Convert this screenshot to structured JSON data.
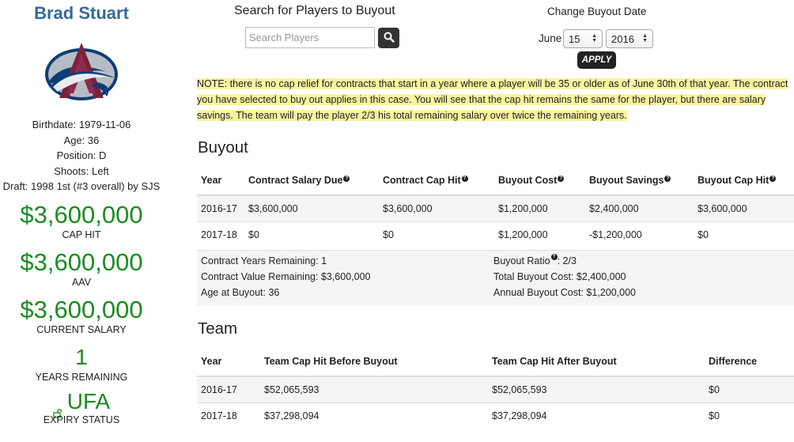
{
  "player": {
    "name": "Brad Stuart",
    "birthdate": "Birthdate: 1979-11-06",
    "age": "Age: 36",
    "position": "Position: D",
    "shoots": "Shoots: Left",
    "draft": "Draft: 1998 1st (#3 overall) by SJS"
  },
  "stats": {
    "cap_hit_value": "$3,600,000",
    "cap_hit_label": "CAP HIT",
    "aav_value": "$3,600,000",
    "aav_label": "AAV",
    "salary_value": "$3,600,000",
    "salary_label": "CURRENT SALARY",
    "years_value": "1",
    "years_label": "YEARS REMAINING",
    "expiry_value": "UFA",
    "expiry_label": "EXPIRY STATUS"
  },
  "search": {
    "title": "Search for Players to Buyout",
    "placeholder": "Search Players"
  },
  "date": {
    "title": "Change Buyout Date",
    "month": "June",
    "day": "15",
    "year": "2016",
    "apply_label": "APPLY"
  },
  "note": "NOTE: there is no cap relief for contracts that start in a year where a player will be 35 or older as of June 30th of that year. The contract you have selected to buy out applies in this case. You will see that the cap hit remains the same for the player, but there are salary savings. The team will pay the player 2/3 his total remaining salary over twice the remaining years.",
  "buyout": {
    "title": "Buyout",
    "headers": [
      "Year",
      "Contract Salary Due",
      "Contract Cap Hit",
      "Buyout Cost",
      "Buyout Savings",
      "Buyout Cap Hit"
    ],
    "rows": [
      [
        "2016-17",
        "$3,600,000",
        "$3,600,000",
        "$1,200,000",
        "$2,400,000",
        "$3,600,000"
      ],
      [
        "2017-18",
        "$0",
        "$0",
        "$1,200,000",
        "-$1,200,000",
        "$0"
      ]
    ],
    "summary": {
      "years_remaining": "Contract Years Remaining: 1",
      "value_remaining": "Contract Value Remaining: $3,600,000",
      "age_at_buyout": "Age at Buyout: 36",
      "ratio_label": "Buyout Ratio",
      "ratio_value": ": 2/3",
      "total_cost": "Total Buyout Cost: $2,400,000",
      "annual_cost": "Annual Buyout Cost: $1,200,000"
    }
  },
  "team": {
    "title": "Team",
    "headers": [
      "Year",
      "Team Cap Hit Before Buyout",
      "Team Cap Hit After Buyout",
      "Difference"
    ],
    "rows": [
      [
        "2016-17",
        "$52,065,593",
        "$52,065,593",
        "$0"
      ],
      [
        "2017-18",
        "$37,298,094",
        "$37,298,094",
        "$0"
      ]
    ]
  },
  "colors": {
    "name_blue": "#34699a",
    "stat_green": "#1b8c21",
    "note_highlight": "#fbf49e"
  },
  "icons": {
    "search": "search-icon",
    "help": "question-icon",
    "lock": "unlock-icon"
  }
}
